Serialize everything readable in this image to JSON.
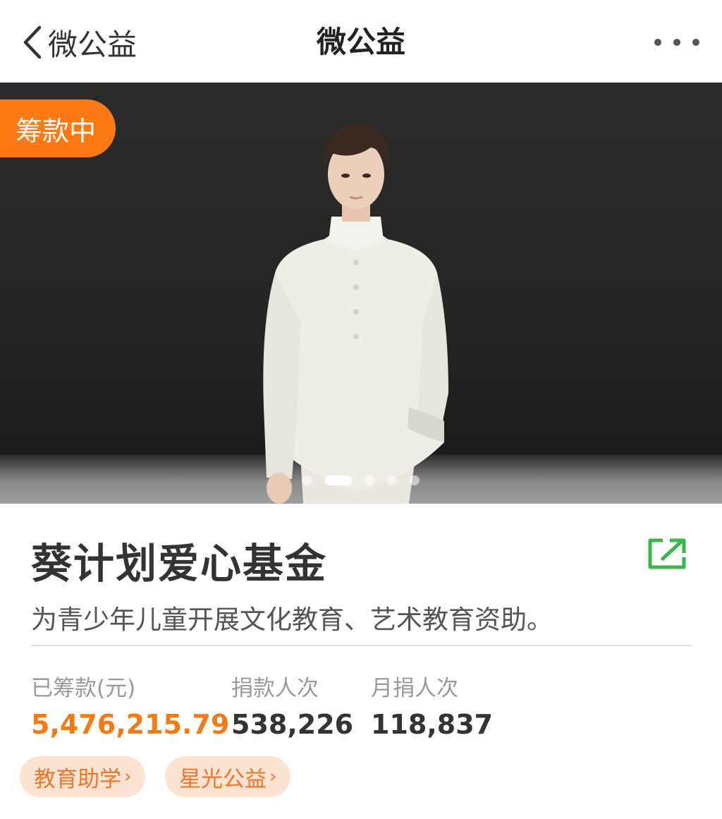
{
  "nav": {
    "back_label": "微公益",
    "title": "微公益"
  },
  "hero": {
    "badge": "筹款中",
    "carousel": {
      "total": 5,
      "active": 1
    }
  },
  "project": {
    "title": "葵计划爱心基金",
    "description": "为青少年儿童开展文化教育、艺术教育资助。"
  },
  "stats": [
    {
      "label": "已筹款(元)",
      "value": "5,476,215.79"
    },
    {
      "label": "捐款人次",
      "value": "538,226"
    },
    {
      "label": "月捐人次",
      "value": "118,837"
    }
  ],
  "tags": [
    {
      "label": "教育助学",
      "arrow": "›"
    },
    {
      "label": "星光公益",
      "arrow": "›"
    }
  ],
  "colors": {
    "accent": "#ff7a14",
    "share_icon": "#3ab549",
    "tag_bg": "#fde3d1"
  }
}
